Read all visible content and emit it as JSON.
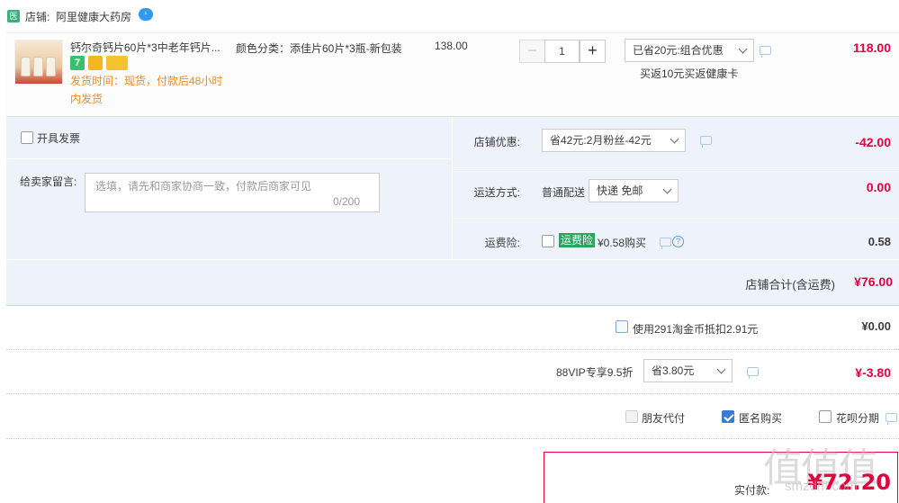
{
  "shop": {
    "badge": "医",
    "label": "店铺:",
    "name": "阿里健康大药房"
  },
  "item": {
    "title": "钙尔奇钙片60片*3中老年钙片...",
    "ship_time": "发货时间：现货，付款后48小时内发货",
    "tag_icon_text": "7",
    "variant": "颜色分类：添佳片60片*3瓶-新包装",
    "unit_price": "138.00",
    "quantity": "1",
    "minus_label": "−",
    "plus_label": "+",
    "promo_selected": "已省20元:组合优惠",
    "promo_note": "买返10元买返健康卡",
    "total": "118.00"
  },
  "options": {
    "invoice_label": "开具发票",
    "message_label": "给卖家留言:",
    "message_placeholder": "选填，请先和商家协商一致，付款后商家可见",
    "message_count": "0/200",
    "coupon_label": "店铺优惠:",
    "coupon_selected": "省42元:2月粉丝-42元",
    "coupon_amount": "-42.00",
    "shipping_label": "运送方式:",
    "shipping_type": "普通配送",
    "shipping_selected": "快递 免邮",
    "shipping_amount": "0.00",
    "insurance_label": "运费险:",
    "insurance_tag": "运费险",
    "insurance_price": "¥0.58购买",
    "insurance_help": "?",
    "insurance_amount": "0.58",
    "subtotal_label": "店铺合计(含运费)",
    "subtotal_value": "¥76.00"
  },
  "coins": {
    "label": "使用291淘金币抵扣2.91元",
    "amount": "¥0.00"
  },
  "vip": {
    "label": "88VIP专享9.5折",
    "selected": "省3.80元",
    "amount": "¥-3.80"
  },
  "checkout_options": {
    "friend_pay": "朋友代付",
    "anonymous": "匿名购买",
    "huabei": "花呗分期"
  },
  "payment": {
    "label": "实付款:",
    "amount": "¥72.20"
  },
  "watermark": {
    "text": "值值值",
    "sub": "smzdm.com"
  },
  "colors": {
    "price_red": "#e6003c",
    "panel_blue": "#eef3fb",
    "ship_orange": "#f08a24",
    "insurance_green": "#25a85b",
    "check_blue": "#3a7bd5"
  }
}
